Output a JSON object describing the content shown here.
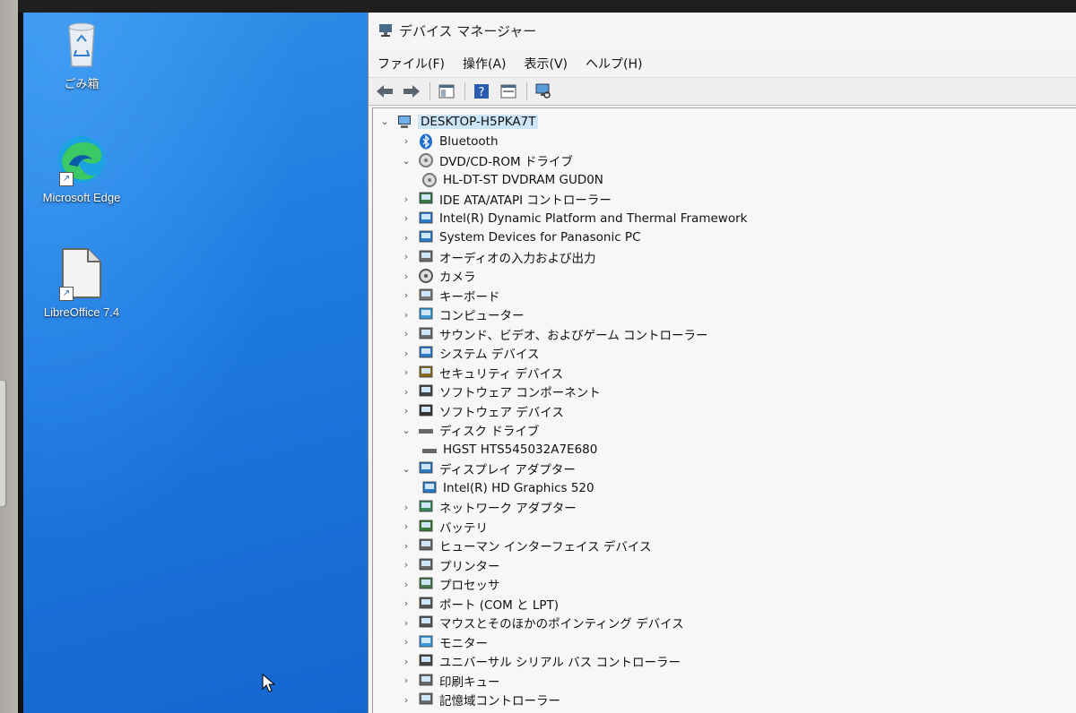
{
  "desktop": {
    "icons": [
      {
        "label": "ごみ箱"
      },
      {
        "label": "Microsoft Edge"
      },
      {
        "label": "LibreOffice 7.4"
      }
    ]
  },
  "window": {
    "title": "デバイス マネージャー",
    "menu": [
      "ファイル(F)",
      "操作(A)",
      "表示(V)",
      "ヘルプ(H)"
    ]
  },
  "tree": {
    "root": "DESKTOP-H5PKA7T",
    "items": [
      {
        "label": "Bluetooth",
        "expanded": false,
        "icon": "bluetooth-icon"
      },
      {
        "label": "DVD/CD-ROM ドライブ",
        "expanded": true,
        "icon": "dvd-drive-icon"
      },
      {
        "label": "HL-DT-ST DVDRAM GUD0N",
        "child": true,
        "icon": "dvd-drive-icon"
      },
      {
        "label": "IDE ATA/ATAPI コントローラー",
        "expanded": false,
        "icon": "ide-controller-icon"
      },
      {
        "label": "Intel(R) Dynamic Platform and Thermal Framework",
        "expanded": false,
        "icon": "system-device-icon"
      },
      {
        "label": "System Devices for Panasonic PC",
        "expanded": false,
        "icon": "system-device-icon"
      },
      {
        "label": "オーディオの入力および出力",
        "expanded": false,
        "icon": "speaker-icon"
      },
      {
        "label": "カメラ",
        "expanded": false,
        "icon": "camera-icon"
      },
      {
        "label": "キーボード",
        "expanded": false,
        "icon": "keyboard-icon"
      },
      {
        "label": "コンピューター",
        "expanded": false,
        "icon": "computer-icon"
      },
      {
        "label": "サウンド、ビデオ、およびゲーム コントローラー",
        "expanded": false,
        "icon": "speaker-icon"
      },
      {
        "label": "システム デバイス",
        "expanded": false,
        "icon": "system-device-icon"
      },
      {
        "label": "セキュリティ デバイス",
        "expanded": false,
        "icon": "security-device-icon"
      },
      {
        "label": "ソフトウェア コンポーネント",
        "expanded": false,
        "icon": "software-component-icon"
      },
      {
        "label": "ソフトウェア デバイス",
        "expanded": false,
        "icon": "software-device-icon"
      },
      {
        "label": "ディスク ドライブ",
        "expanded": true,
        "icon": "disk-drive-icon"
      },
      {
        "label": "HGST HTS545032A7E680",
        "child": true,
        "icon": "disk-drive-icon"
      },
      {
        "label": "ディスプレイ アダプター",
        "expanded": true,
        "icon": "display-adapter-icon"
      },
      {
        "label": "Intel(R) HD Graphics 520",
        "child": true,
        "icon": "display-adapter-icon"
      },
      {
        "label": "ネットワーク アダプター",
        "expanded": false,
        "icon": "network-adapter-icon"
      },
      {
        "label": "バッテリ",
        "expanded": false,
        "icon": "battery-icon"
      },
      {
        "label": "ヒューマン インターフェイス デバイス",
        "expanded": false,
        "icon": "hid-icon"
      },
      {
        "label": "プリンター",
        "expanded": false,
        "icon": "printer-icon"
      },
      {
        "label": "プロセッサ",
        "expanded": false,
        "icon": "processor-icon"
      },
      {
        "label": "ポート (COM と LPT)",
        "expanded": false,
        "icon": "port-icon"
      },
      {
        "label": "マウスとそのほかのポインティング デバイス",
        "expanded": false,
        "icon": "mouse-icon"
      },
      {
        "label": "モニター",
        "expanded": false,
        "icon": "monitor-icon"
      },
      {
        "label": "ユニバーサル シリアル バス コントローラー",
        "expanded": false,
        "icon": "usb-icon"
      },
      {
        "label": "印刷キュー",
        "expanded": false,
        "icon": "print-queue-icon"
      },
      {
        "label": "記憶域コントローラー",
        "expanded": false,
        "icon": "storage-controller-icon"
      }
    ]
  }
}
